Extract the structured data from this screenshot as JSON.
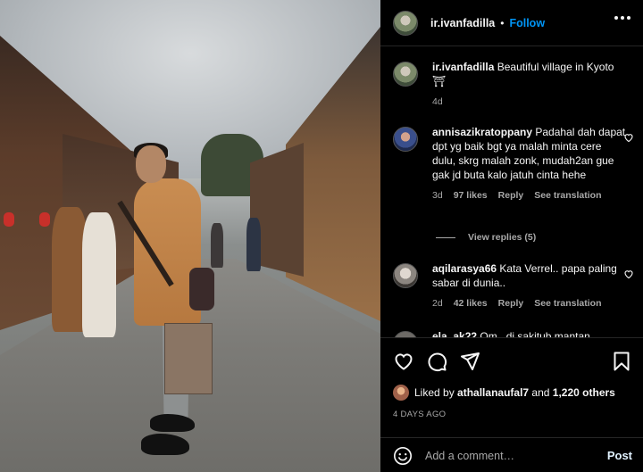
{
  "post": {
    "photo_alt": "",
    "author": "ir.ivanfadilla",
    "separator": "•",
    "follow_label": "Follow",
    "caption_author": "ir.ivanfadilla",
    "caption": "Beautiful village in Kyoto ⛩",
    "caption_age": "4d"
  },
  "comments": [
    {
      "username": "annisazikratoppany",
      "text": "Padahal dah dapat dpt yg baik bgt ya malah minta cere dulu, skrg malah zonk, mudah2an gue gak jd buta kalo jatuh cinta hehe",
      "age": "3d",
      "likes": "97 likes",
      "reply_label": "Reply",
      "translate_label": "See translation"
    },
    {
      "username": "aqilarasya66",
      "text": "Kata Verrel.. papa paling sabar di dunia..",
      "age": "2d",
      "likes": "42 likes",
      "reply_label": "Reply",
      "translate_label": "See translation"
    },
    {
      "username": "ela_ak22",
      "text": "Om.. di sakitub mantan",
      "age": "",
      "likes": "",
      "reply_label": "",
      "translate_label": ""
    }
  ],
  "view_replies": "View replies (5)",
  "likes_summary": {
    "prefix": "Liked by",
    "user": "athallanaufal7",
    "middle": "and",
    "others": "1,220 others"
  },
  "timestamp": "4 DAYS AGO",
  "comment_box": {
    "placeholder": "Add a comment…",
    "post_label": "Post"
  },
  "icons": {
    "more": "more-horizontal-icon",
    "like": "heart-icon",
    "comment": "comment-bubble-icon",
    "share": "paper-plane-icon",
    "save": "bookmark-icon",
    "emoji": "smiley-icon"
  },
  "colors": {
    "background": "#000000",
    "follow": "#0095f6",
    "text": "#f5f5f5",
    "muted": "#a8a8a8",
    "divider": "#262626"
  }
}
